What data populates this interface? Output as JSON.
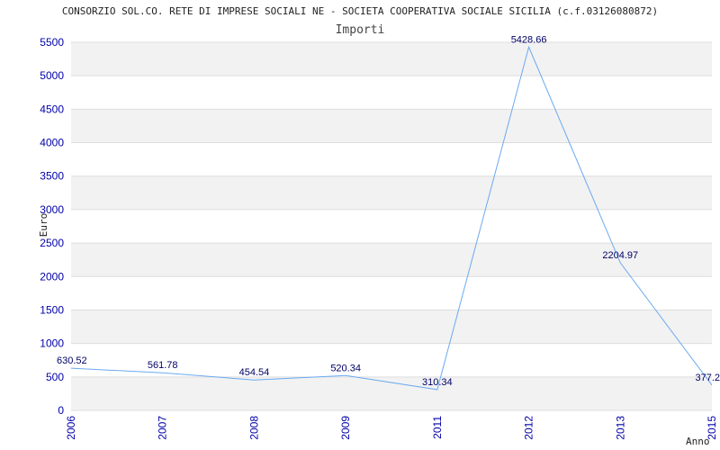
{
  "chart_data": {
    "type": "line",
    "title": "CONSORZIO SOL.CO. RETE DI IMPRESE SOCIALI NE - SOCIETA COOPERATIVA SOCIALE SICILIA (c.f.03126080872)",
    "subtitle": "Importi",
    "xlabel": "Anno",
    "ylabel": "Euro",
    "categories": [
      "2006",
      "2007",
      "2008",
      "2009",
      "2011",
      "2012",
      "2013",
      "2015"
    ],
    "values": [
      630.52,
      561.78,
      454.54,
      520.34,
      310.34,
      5428.66,
      2204.97,
      377.2
    ],
    "value_labels": [
      "630.52",
      "561.78",
      "454.54",
      "520.34",
      "310.34",
      "5428.66",
      "2204.97",
      "377.2"
    ],
    "ylim": [
      0,
      5500
    ],
    "yticks": [
      0,
      500,
      1000,
      1500,
      2000,
      2500,
      3000,
      3500,
      4000,
      4500,
      5000,
      5500
    ],
    "grid": true,
    "line_color": "#6aaaf0",
    "tick_color": "#0000aa",
    "band_color": "#f2f2f2"
  }
}
